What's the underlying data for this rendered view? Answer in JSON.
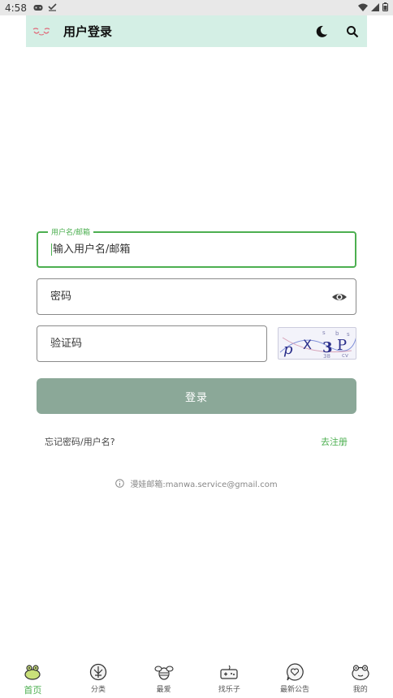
{
  "status_bar": {
    "time": "4:58",
    "icons": [
      "gamepad-icon",
      "check-icon"
    ],
    "right_icons": [
      "wifi-icon",
      "signal-icon",
      "battery-icon"
    ]
  },
  "app_bar": {
    "title": "用户登录",
    "background": "#d4efe5",
    "actions": [
      "dark-mode-icon",
      "search-icon"
    ]
  },
  "form": {
    "username": {
      "label": "用户名/邮箱",
      "placeholder": "输入用户名/邮箱"
    },
    "password": {
      "placeholder": "密码"
    },
    "captcha": {
      "placeholder": "验证码",
      "image_text": "pX3P"
    },
    "login_label": "登录",
    "accent": "#4caf50",
    "button_color": "#8ba898"
  },
  "links": {
    "forgot": "忘记密码/用户名?",
    "register": "去注册"
  },
  "info": {
    "text": "漫娃邮箱:manwa.service@gmail.com"
  },
  "bottom_nav": {
    "items": [
      {
        "label": "首页",
        "icon": "home-icon",
        "active": true
      },
      {
        "label": "分类",
        "icon": "category-icon",
        "active": false
      },
      {
        "label": "最爱",
        "icon": "favorite-icon",
        "active": false
      },
      {
        "label": "找乐子",
        "icon": "game-icon",
        "active": false
      },
      {
        "label": "最新公告",
        "icon": "announcement-icon",
        "active": false
      },
      {
        "label": "我的",
        "icon": "profile-icon",
        "active": false
      }
    ]
  }
}
